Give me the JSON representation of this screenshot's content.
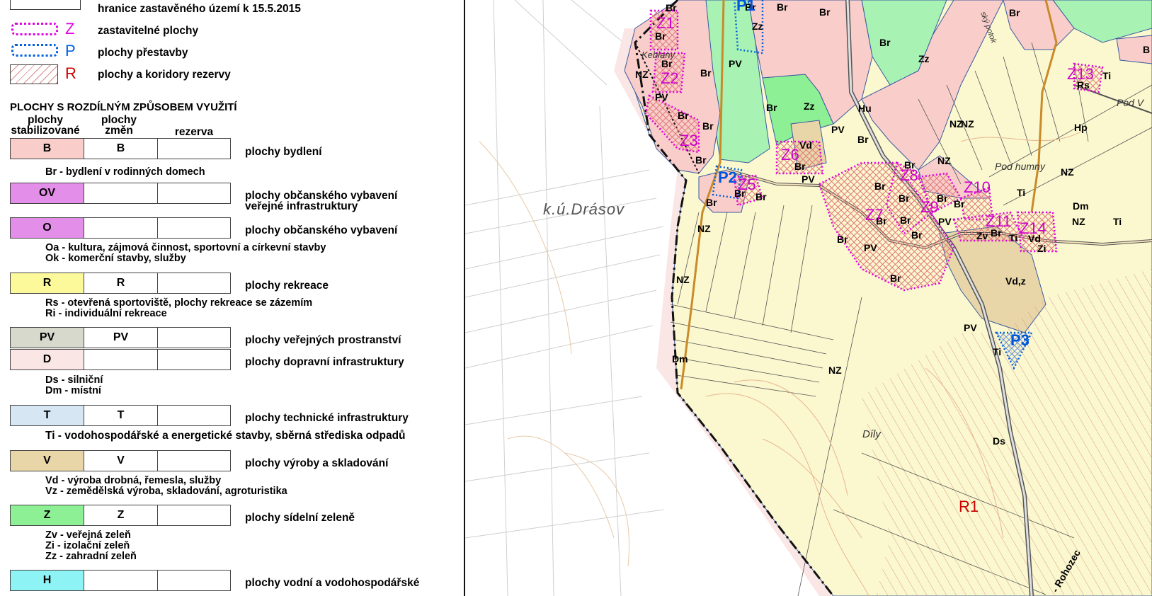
{
  "legend": {
    "key_items": [
      {
        "letter": "",
        "label": "hranice zastavěného území k 15.5.2015"
      },
      {
        "letter": "Z",
        "label": "zastavitelné plochy"
      },
      {
        "letter": "P",
        "label": "plochy přestavby"
      },
      {
        "letter": "R",
        "label": "plochy a koridory rezervy"
      }
    ],
    "section_title": "PLOCHY S ROZDÍLNÝM ZPŮSOBEM VYUŽITÍ",
    "col_headers": {
      "stab_1": "plochy",
      "stab_2": "stabilizované",
      "chg_1": "plochy",
      "chg_2": "změn",
      "res": "rezerva"
    },
    "categories": [
      {
        "code": "B",
        "change": "B",
        "label": "plochy bydlení",
        "sub": [
          "Br - bydlení v rodinných domech"
        ]
      },
      {
        "code": "OV",
        "change": "",
        "label": "plochy občanského vybavení",
        "label2": "veřejné infrastruktury",
        "sub": []
      },
      {
        "code": "O",
        "change": "",
        "label": "plochy občanského vybavení",
        "sub": [
          "Oa - kultura, zájmová činnost, sportovní a církevní stavby",
          "Ok - komerční stavby, služby"
        ]
      },
      {
        "code": "R",
        "change": "R",
        "label": "plochy rekreace",
        "sub": [
          "Rs - otevřená sportoviště, plochy rekreace se zázemím",
          "Ri  - individuální rekreace"
        ]
      },
      {
        "code": "PV",
        "change": "PV",
        "label": "plochy veřejných prostranství",
        "sub": []
      },
      {
        "code": "D",
        "change": "",
        "label": "plochy dopravní infrastruktury",
        "sub": [
          "Ds  - silniční",
          "Dm - místní"
        ]
      },
      {
        "code": "T",
        "change": "T",
        "label": "plochy technické infrastruktury",
        "sub": [
          "Ti  - vodohospodářské a energetické stavby, sběrná střediska odpadů"
        ]
      },
      {
        "code": "V",
        "change": "V",
        "label": "plochy výroby a skladování",
        "sub": [
          "Vd - výroba drobná, řemesla, služby",
          "Vz - zemědělská výroba, skladování, agroturistika"
        ]
      },
      {
        "code": "Z",
        "change": "Z",
        "label": "plochy sídelní zeleně",
        "sub": [
          "Zv - veřejná zeleň",
          "Zi  - izolační zeleň",
          "Zz - zahradní zeleň"
        ]
      },
      {
        "code": "H",
        "change": "",
        "label": "plochy vodní a vodohospodářské",
        "sub": []
      }
    ]
  },
  "colors": {
    "B": "#f9cdc9",
    "OV": "#e38ee8",
    "O": "#e38ee8",
    "R": "#fcf99a",
    "PV": "#d6d9cc",
    "D": "#fbe6e6",
    "T": "#d6e6f2",
    "V": "#e8d6a8",
    "Z": "#8ef094",
    "H": "#8ef3f5",
    "key_Z": "#e000e0",
    "key_P": "#0060e0",
    "key_R": "#cc0000",
    "nz_field": "#fbf8cf",
    "zz_green": "#a8f2b4",
    "built": "#f9cdc9",
    "vd": "#e8d6a8"
  },
  "map_labels": {
    "cadastre": "k.ú.Drásov",
    "keblany": "Keblany",
    "pod_humny": "Pod  humny",
    "pod_v": "Pod  V",
    "dily": "Díly",
    "rohozec": "- Rohozec",
    "potok": "ský potok",
    "z_codes": [
      "Z1",
      "Z2",
      "Z3",
      "Z5",
      "Z6",
      "Z7",
      "Z8",
      "Z9",
      "Z10",
      "Z11",
      "Z13",
      "Z14"
    ],
    "p_codes": [
      "P1",
      "P2",
      "P3"
    ],
    "r_codes": [
      "R1"
    ],
    "types": [
      "Br",
      "NZ",
      "PV",
      "Zz",
      "Hu",
      "Vd",
      "Hp",
      "Dm",
      "Ti",
      "Rs",
      "Zv",
      "Zi",
      "Vd,z",
      "Ds",
      "Zv",
      "B"
    ]
  }
}
